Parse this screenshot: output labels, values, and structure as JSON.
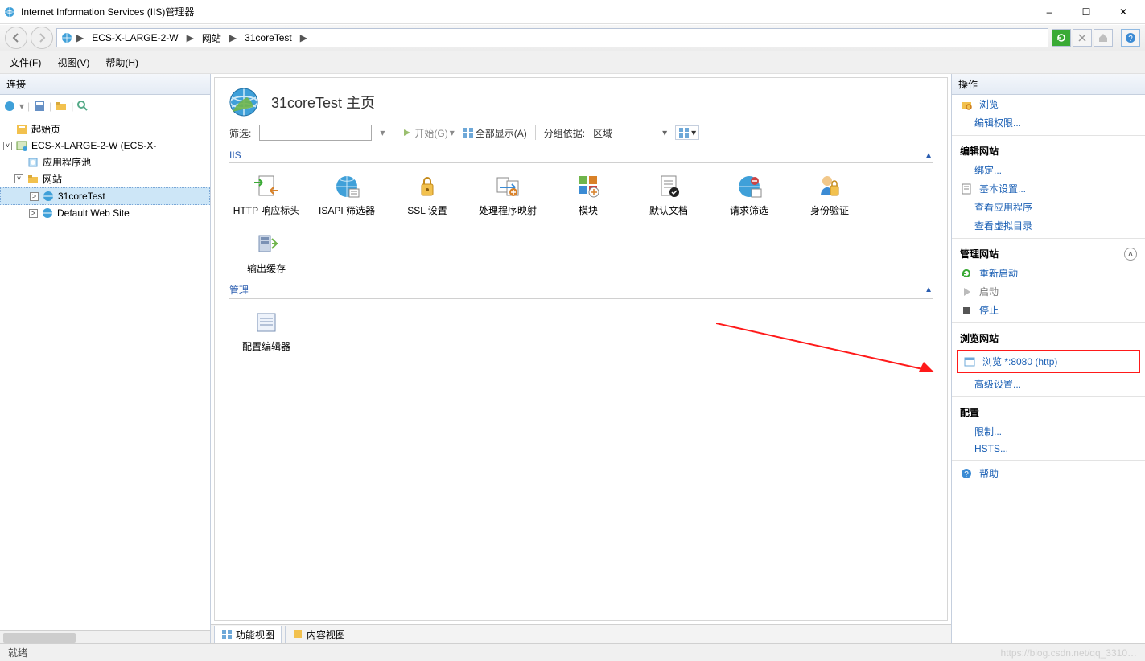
{
  "title": "Internet Information Services (IIS)管理器",
  "window_buttons": {
    "min": "–",
    "max": "☐",
    "close": "✕"
  },
  "breadcrumb": [
    "ECS-X-LARGE-2-W",
    "网站",
    "31coreTest"
  ],
  "menubar": {
    "file": "文件(F)",
    "view": "视图(V)",
    "help": "帮助(H)"
  },
  "left": {
    "header": "连接",
    "tree": {
      "start": "起始页",
      "server": "ECS-X-LARGE-2-W (ECS-X-",
      "apppool": "应用程序池",
      "sites": "网站",
      "site_selected": "31coreTest",
      "site_default": "Default Web Site"
    }
  },
  "center": {
    "title": "31coreTest 主页",
    "filter_label": "筛选:",
    "start": "开始(G)",
    "show_all": "全部显示(A)",
    "group_by": "分组依据:",
    "group_value": "区域",
    "groups": {
      "iis": "IIS",
      "mgmt": "管理"
    },
    "features_iis": [
      "HTTP 响应标头",
      "ISAPI 筛选器",
      "SSL 设置",
      "处理程序映射",
      "模块",
      "默认文档",
      "请求筛选",
      "身份验证",
      "输出缓存"
    ],
    "features_mgmt": [
      "配置编辑器"
    ],
    "tabs": {
      "features": "功能视图",
      "content": "内容视图"
    }
  },
  "right": {
    "header": "操作",
    "browse": "浏览",
    "edit_perm": "编辑权限...",
    "edit_site": "编辑网站",
    "bindings": "绑定...",
    "basic": "基本设置...",
    "view_apps": "查看应用程序",
    "view_vdir": "查看虚拟目录",
    "manage_site": "管理网站",
    "restart": "重新启动",
    "start": "启动",
    "stop": "停止",
    "browse_site": "浏览网站",
    "browse_8080": "浏览 *:8080 (http)",
    "advanced": "高级设置...",
    "config": "配置",
    "limits": "限制...",
    "hsts": "HSTS...",
    "help": "帮助"
  },
  "status": "就绪",
  "watermark": "https://blog.csdn.net/qq_3310…"
}
